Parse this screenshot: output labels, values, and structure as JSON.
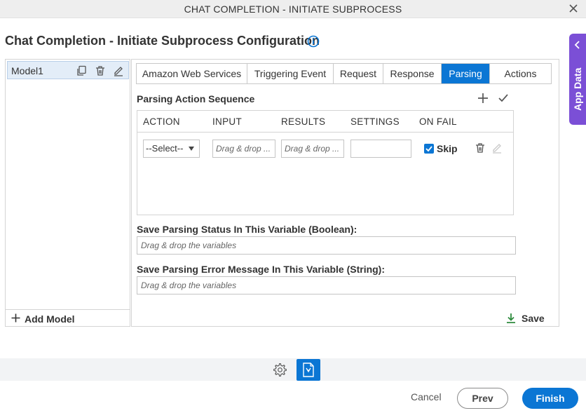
{
  "window": {
    "title": "CHAT COMPLETION - INITIATE SUBPROCESS",
    "close_icon": "close-icon"
  },
  "page": {
    "title": "Chat Completion - Initiate Subprocess Configuration",
    "info_icon": "info-icon"
  },
  "app_data": {
    "label": "App Data",
    "icon": "chevron-left-icon"
  },
  "models": {
    "items": [
      {
        "label": "Model1"
      }
    ],
    "add_label": "Add Model",
    "icons": [
      "copy-icon",
      "trash-icon",
      "edit-icon"
    ]
  },
  "tabs": [
    {
      "label": "Amazon Web Services",
      "active": false
    },
    {
      "label": "Triggering Event",
      "active": false
    },
    {
      "label": "Request",
      "active": false
    },
    {
      "label": "Response",
      "active": false
    },
    {
      "label": "Parsing",
      "active": true
    },
    {
      "label": "Actions",
      "active": false
    }
  ],
  "parsing": {
    "sequence_label": "Parsing Action Sequence",
    "columns": [
      "ACTION",
      "INPUT",
      "RESULTS",
      "SETTINGS",
      "ON FAIL"
    ],
    "rows": [
      {
        "action": "--Select--",
        "input_placeholder": "Drag & drop ...",
        "results_placeholder": "Drag & drop ...",
        "settings": "",
        "on_fail_checked": true,
        "on_fail_label": "Skip"
      }
    ],
    "status_label": "Save Parsing Status In This Variable (Boolean):",
    "status_placeholder": "Drag & drop the variables",
    "error_label": "Save Parsing Error Message In This Variable (String):",
    "error_placeholder": "Drag & drop the variables",
    "save_label": "Save"
  },
  "footer": {
    "cancel": "Cancel",
    "prev": "Prev",
    "finish": "Finish"
  },
  "colors": {
    "accent": "#0b76d4",
    "app_data": "#7b4fd6",
    "save_icon": "#2e8b3e"
  }
}
